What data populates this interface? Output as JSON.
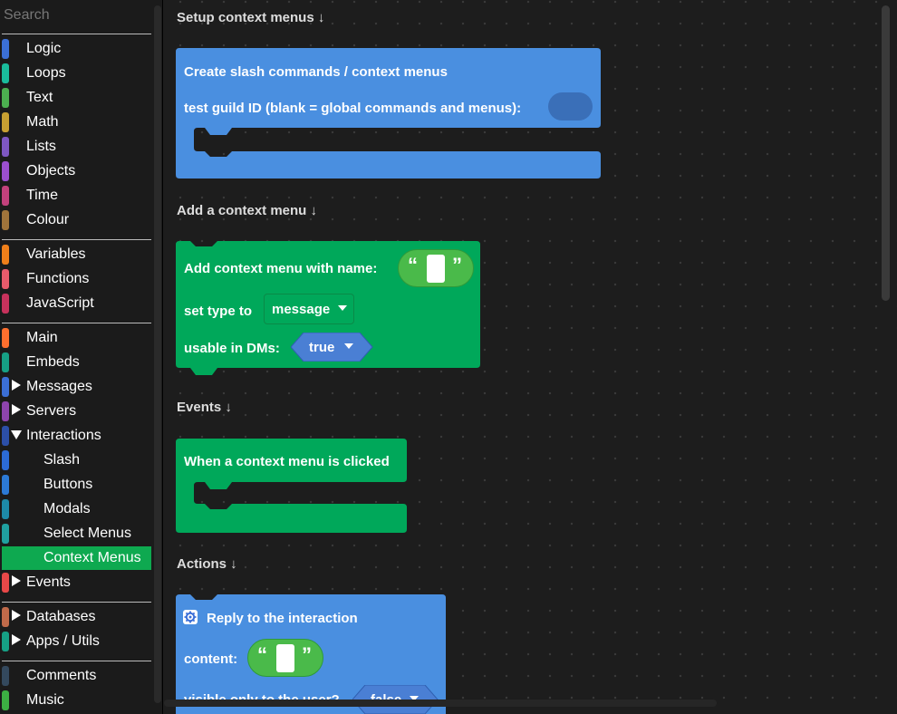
{
  "search": {
    "placeholder": "Search"
  },
  "categories": [
    {
      "label": "Logic",
      "color": "#3b6fd6"
    },
    {
      "label": "Loops",
      "color": "#1abc9c"
    },
    {
      "label": "Text",
      "color": "#4caf50"
    },
    {
      "label": "Math",
      "color": "#c8a032"
    },
    {
      "label": "Lists",
      "color": "#7e57c2"
    },
    {
      "label": "Objects",
      "color": "#9c4fcf"
    },
    {
      "label": "Time",
      "color": "#c2417c"
    },
    {
      "label": "Colour",
      "color": "#a0743b"
    },
    {
      "label": "Variables",
      "color": "#ef7f1a"
    },
    {
      "label": "Functions",
      "color": "#e85b6b"
    },
    {
      "label": "JavaScript",
      "color": "#c7325c"
    },
    {
      "label": "Main",
      "color": "#ff6f2e"
    },
    {
      "label": "Embeds",
      "color": "#16a085"
    },
    {
      "label": "Messages",
      "color": "#3b6fd6",
      "arrow": "right"
    },
    {
      "label": "Servers",
      "color": "#8e44ad",
      "arrow": "right"
    },
    {
      "label": "Interactions",
      "color": "#2c4fa8",
      "arrow": "down"
    },
    {
      "label": "Slash",
      "color": "#2c6bd6",
      "sub": true
    },
    {
      "label": "Buttons",
      "color": "#2c7ad6",
      "sub": true
    },
    {
      "label": "Modals",
      "color": "#1d8aa8",
      "sub": true
    },
    {
      "label": "Select Menus",
      "color": "#20a0a0",
      "sub": true
    },
    {
      "label": "Context Menus",
      "color": "#0ea950",
      "sub": true,
      "selected": true
    },
    {
      "label": "Events",
      "color": "#e84848",
      "arrow": "right"
    },
    {
      "label": "Databases",
      "color": "#c06a4a",
      "arrow": "right"
    },
    {
      "label": "Apps / Utils",
      "color": "#16a085",
      "arrow": "right"
    },
    {
      "label": "Comments",
      "color": "#34495e"
    },
    {
      "label": "Music",
      "color": "#3cb043"
    }
  ],
  "colors": {
    "blue": "#4a8fe0",
    "green": "#00a85a",
    "textGreen": "#4aba4a",
    "inputBlue": "#3a6fb8",
    "dropdownBlue": "#4a7fd4"
  },
  "workspace": {
    "headings": [
      "Setup context menus ↓",
      "Add a context menu ↓",
      "Events ↓",
      "Actions ↓"
    ],
    "setup_block": {
      "line1": "Create slash commands / context menus",
      "line2": "test guild ID (blank = global commands and menus):"
    },
    "add_block": {
      "line1": "Add context menu with name:",
      "line2": "set type to",
      "type_value": "message",
      "line3": "usable in DMs:",
      "dms_value": "true"
    },
    "event_block": {
      "line1": "When a context menu is clicked"
    },
    "reply_block": {
      "line1": "Reply to the interaction",
      "line2": "content:",
      "line3": "visible only to the user?",
      "visible_value": "false"
    }
  }
}
